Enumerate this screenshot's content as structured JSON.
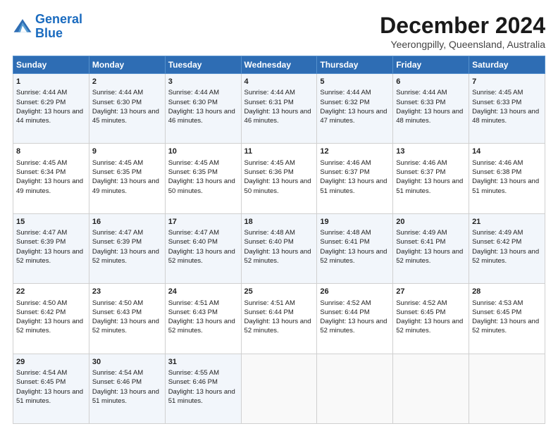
{
  "logo": {
    "line1": "General",
    "line2": "Blue"
  },
  "title": "December 2024",
  "subtitle": "Yeerongpilly, Queensland, Australia",
  "days_of_week": [
    "Sunday",
    "Monday",
    "Tuesday",
    "Wednesday",
    "Thursday",
    "Friday",
    "Saturday"
  ],
  "weeks": [
    [
      {
        "day": "1",
        "sunrise": "4:44 AM",
        "sunset": "6:29 PM",
        "daylight": "13 hours and 44 minutes."
      },
      {
        "day": "2",
        "sunrise": "4:44 AM",
        "sunset": "6:30 PM",
        "daylight": "13 hours and 45 minutes."
      },
      {
        "day": "3",
        "sunrise": "4:44 AM",
        "sunset": "6:30 PM",
        "daylight": "13 hours and 46 minutes."
      },
      {
        "day": "4",
        "sunrise": "4:44 AM",
        "sunset": "6:31 PM",
        "daylight": "13 hours and 46 minutes."
      },
      {
        "day": "5",
        "sunrise": "4:44 AM",
        "sunset": "6:32 PM",
        "daylight": "13 hours and 47 minutes."
      },
      {
        "day": "6",
        "sunrise": "4:44 AM",
        "sunset": "6:33 PM",
        "daylight": "13 hours and 48 minutes."
      },
      {
        "day": "7",
        "sunrise": "4:45 AM",
        "sunset": "6:33 PM",
        "daylight": "13 hours and 48 minutes."
      }
    ],
    [
      {
        "day": "8",
        "sunrise": "4:45 AM",
        "sunset": "6:34 PM",
        "daylight": "13 hours and 49 minutes."
      },
      {
        "day": "9",
        "sunrise": "4:45 AM",
        "sunset": "6:35 PM",
        "daylight": "13 hours and 49 minutes."
      },
      {
        "day": "10",
        "sunrise": "4:45 AM",
        "sunset": "6:35 PM",
        "daylight": "13 hours and 50 minutes."
      },
      {
        "day": "11",
        "sunrise": "4:45 AM",
        "sunset": "6:36 PM",
        "daylight": "13 hours and 50 minutes."
      },
      {
        "day": "12",
        "sunrise": "4:46 AM",
        "sunset": "6:37 PM",
        "daylight": "13 hours and 51 minutes."
      },
      {
        "day": "13",
        "sunrise": "4:46 AM",
        "sunset": "6:37 PM",
        "daylight": "13 hours and 51 minutes."
      },
      {
        "day": "14",
        "sunrise": "4:46 AM",
        "sunset": "6:38 PM",
        "daylight": "13 hours and 51 minutes."
      }
    ],
    [
      {
        "day": "15",
        "sunrise": "4:47 AM",
        "sunset": "6:39 PM",
        "daylight": "13 hours and 52 minutes."
      },
      {
        "day": "16",
        "sunrise": "4:47 AM",
        "sunset": "6:39 PM",
        "daylight": "13 hours and 52 minutes."
      },
      {
        "day": "17",
        "sunrise": "4:47 AM",
        "sunset": "6:40 PM",
        "daylight": "13 hours and 52 minutes."
      },
      {
        "day": "18",
        "sunrise": "4:48 AM",
        "sunset": "6:40 PM",
        "daylight": "13 hours and 52 minutes."
      },
      {
        "day": "19",
        "sunrise": "4:48 AM",
        "sunset": "6:41 PM",
        "daylight": "13 hours and 52 minutes."
      },
      {
        "day": "20",
        "sunrise": "4:49 AM",
        "sunset": "6:41 PM",
        "daylight": "13 hours and 52 minutes."
      },
      {
        "day": "21",
        "sunrise": "4:49 AM",
        "sunset": "6:42 PM",
        "daylight": "13 hours and 52 minutes."
      }
    ],
    [
      {
        "day": "22",
        "sunrise": "4:50 AM",
        "sunset": "6:42 PM",
        "daylight": "13 hours and 52 minutes."
      },
      {
        "day": "23",
        "sunrise": "4:50 AM",
        "sunset": "6:43 PM",
        "daylight": "13 hours and 52 minutes."
      },
      {
        "day": "24",
        "sunrise": "4:51 AM",
        "sunset": "6:43 PM",
        "daylight": "13 hours and 52 minutes."
      },
      {
        "day": "25",
        "sunrise": "4:51 AM",
        "sunset": "6:44 PM",
        "daylight": "13 hours and 52 minutes."
      },
      {
        "day": "26",
        "sunrise": "4:52 AM",
        "sunset": "6:44 PM",
        "daylight": "13 hours and 52 minutes."
      },
      {
        "day": "27",
        "sunrise": "4:52 AM",
        "sunset": "6:45 PM",
        "daylight": "13 hours and 52 minutes."
      },
      {
        "day": "28",
        "sunrise": "4:53 AM",
        "sunset": "6:45 PM",
        "daylight": "13 hours and 52 minutes."
      }
    ],
    [
      {
        "day": "29",
        "sunrise": "4:54 AM",
        "sunset": "6:45 PM",
        "daylight": "13 hours and 51 minutes."
      },
      {
        "day": "30",
        "sunrise": "4:54 AM",
        "sunset": "6:46 PM",
        "daylight": "13 hours and 51 minutes."
      },
      {
        "day": "31",
        "sunrise": "4:55 AM",
        "sunset": "6:46 PM",
        "daylight": "13 hours and 51 minutes."
      },
      null,
      null,
      null,
      null
    ]
  ]
}
